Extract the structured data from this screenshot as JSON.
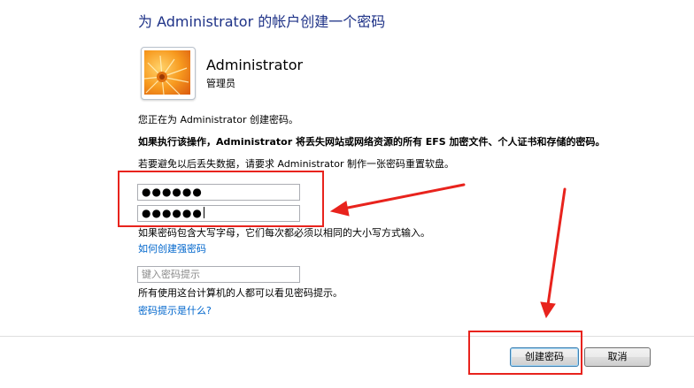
{
  "header": {
    "title": "为 Administrator 的帐户创建一个密码"
  },
  "user": {
    "name": "Administrator",
    "type": "管理员",
    "avatar_icon": "orange-flower-icon"
  },
  "messages": {
    "creating_for": "您正在为 Administrator 创建密码。",
    "warning": "如果执行该操作，Administrator 将丢失网站或网络资源的所有 EFS 加密文件、个人证书和存储的密码。",
    "recommend": "若要避免以后丢失数据，请要求 Administrator 制作一张密码重置软盘。",
    "case_note": "如果密码包含大写字母，它们每次都必须以相同的大小写方式输入。",
    "hint_note": "所有使用这台计算机的人都可以看见密码提示。"
  },
  "form": {
    "new_password": "●●●●●●",
    "confirm_password": "●●●●●●",
    "hint_placeholder": "键入密码提示"
  },
  "links": {
    "strong_password": "如何创建强密码",
    "what_is_hint": "密码提示是什么?"
  },
  "buttons": {
    "create": "创建密码",
    "cancel": "取消"
  },
  "annotations": {
    "color": "#e8231d"
  }
}
